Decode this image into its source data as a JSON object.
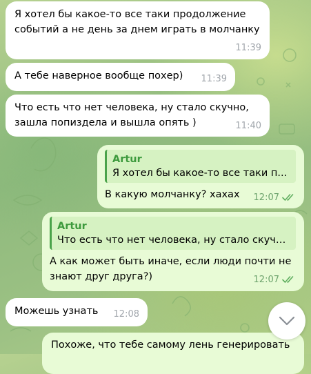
{
  "messages": [
    {
      "direction": "incoming",
      "text": "Я хотел бы какое-то все таки продолжение событий а не день за днем играть в молчанку",
      "time": "11:39"
    },
    {
      "direction": "incoming",
      "text": "А тебе наверное вообще похер)",
      "time": "11:39"
    },
    {
      "direction": "incoming",
      "text": "Что есть что нет человека, ну стало скучно, зашла попиздела и вышла опять )",
      "time": "11:40"
    },
    {
      "direction": "outgoing",
      "reply_author": "Artur",
      "reply_text": "Я хотел бы какое-то все таки п...",
      "text": "В какую молчанку? хахах",
      "time": "12:07",
      "status_icon": "double-check-icon"
    },
    {
      "direction": "outgoing",
      "reply_author": "Artur",
      "reply_text": "Что есть что нет человека, ну стало скучн...",
      "text": "А как может быть иначе, если люди почти не знают друг друга?)",
      "time": "12:07",
      "status_icon": "double-check-icon"
    },
    {
      "direction": "incoming",
      "text": "Можешь узнать",
      "time": "12:08"
    },
    {
      "direction": "outgoing",
      "text": "Похоже, что тебе самому лень генерировать",
      "time": ""
    }
  ],
  "scroll_button": {
    "icon": "chevron-down-icon"
  },
  "colors": {
    "incoming_bubble": "#ffffff",
    "outgoing_bubble": "#e8fbd6",
    "reply_accent": "#4aa34a",
    "reply_author": "#3d9a3d",
    "incoming_time": "#a0a5ab",
    "outgoing_time": "#6ba26b"
  }
}
